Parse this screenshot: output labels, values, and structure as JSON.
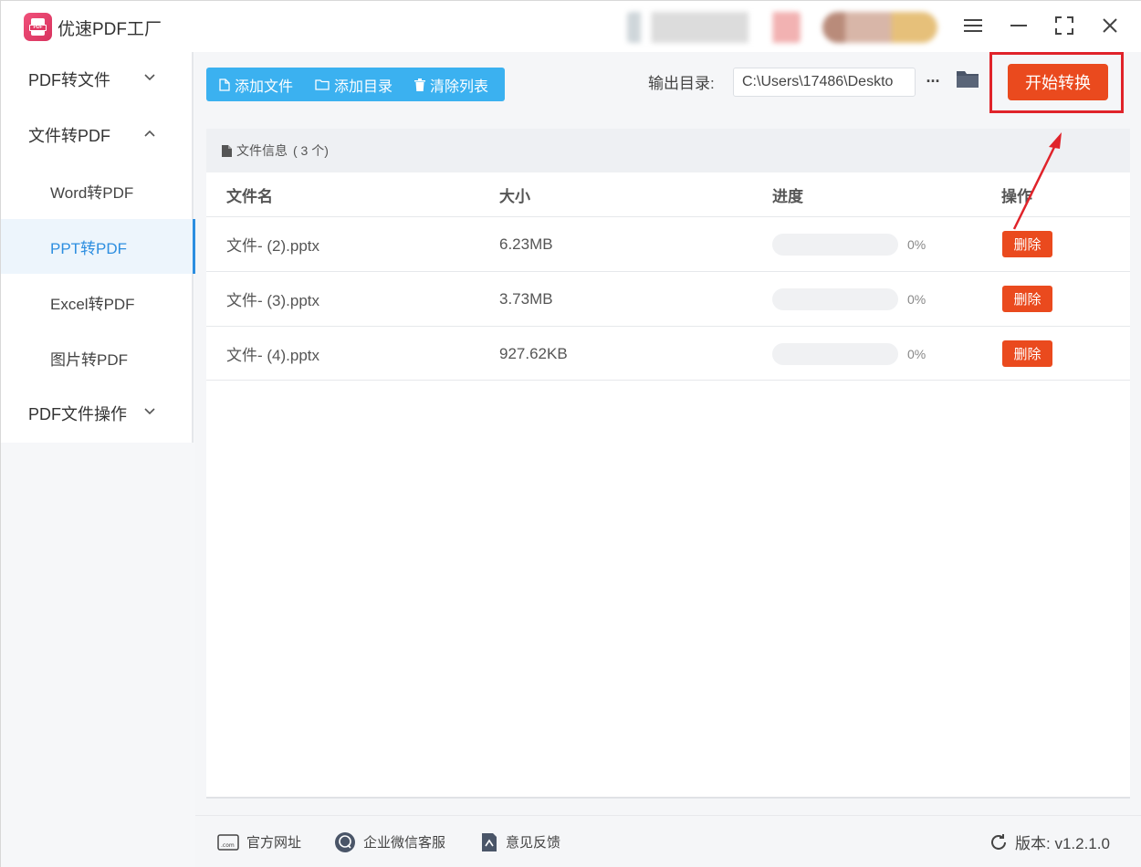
{
  "app": {
    "title": "优速PDF工厂",
    "logo_text": "PDF"
  },
  "sidebar": {
    "groups": [
      {
        "label": "PDF转文件",
        "expanded": false
      },
      {
        "label": "文件转PDF",
        "expanded": true
      },
      {
        "label": "PDF文件操作",
        "expanded": false
      }
    ],
    "items": [
      {
        "label": "Word转PDF",
        "active": false
      },
      {
        "label": "PPT转PDF",
        "active": true
      },
      {
        "label": "Excel转PDF",
        "active": false
      },
      {
        "label": "图片转PDF",
        "active": false
      }
    ]
  },
  "toolbar": {
    "add_file": "添加文件",
    "add_folder": "添加目录",
    "clear_list": "清除列表",
    "output_label": "输出目录:",
    "output_path": "C:\\Users\\17486\\Deskto",
    "more_label": "···",
    "start_button": "开始转换"
  },
  "file_panel": {
    "header_label": "文件信息",
    "count_text": "( 3 个)",
    "columns": [
      "文件名",
      "大小",
      "进度",
      "操作"
    ],
    "rows": [
      {
        "name": "文件- (2).pptx",
        "size": "6.23MB",
        "progress": 0,
        "progress_text": "0%",
        "action": "删除"
      },
      {
        "name": "文件- (3).pptx",
        "size": "3.73MB",
        "progress": 0,
        "progress_text": "0%",
        "action": "删除"
      },
      {
        "name": "文件- (4).pptx",
        "size": "927.62KB",
        "progress": 0,
        "progress_text": "0%",
        "action": "删除"
      }
    ]
  },
  "footer": {
    "website": "官方网址",
    "wechat": "企业微信客服",
    "feedback": "意见反馈",
    "version": "版本:  v1.2.1.0"
  },
  "colors": {
    "accent_blue": "#3bb1f0",
    "active_text": "#2d8ee0",
    "action_red": "#ea4a1e",
    "highlight_red": "#e0232a"
  }
}
